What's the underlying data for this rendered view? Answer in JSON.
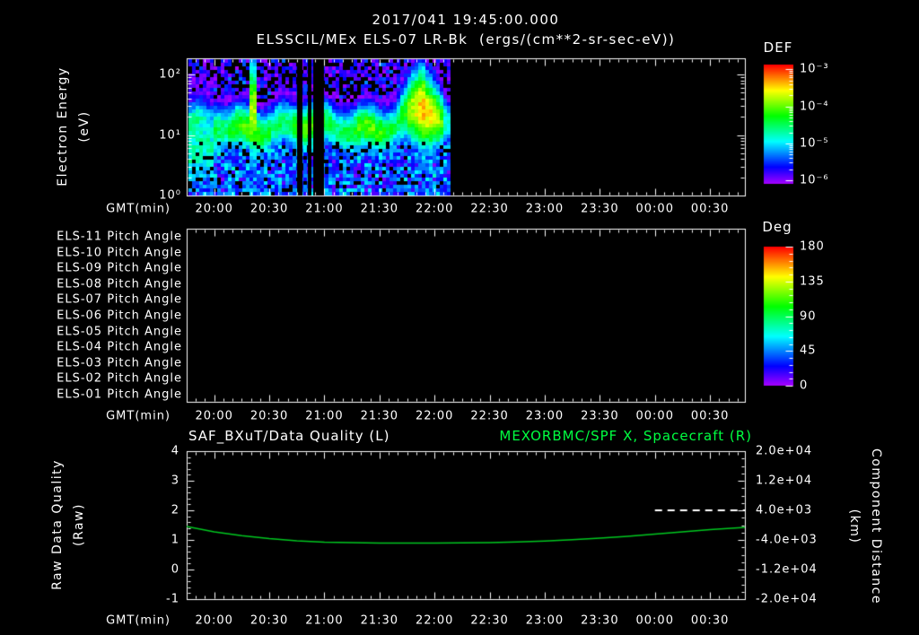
{
  "colors": {
    "background": "#000000",
    "text": "#ffffff",
    "accent_green": "#00ff41",
    "spacecraft_line": "#00c820",
    "quality_line": "#ffffff"
  },
  "title": {
    "line1": "2017/041 19:45:00.000",
    "line2": "ELSSCIL/MEx ELS-07 LR-Bk  (ergs/(cm**2-sr-sec-eV))"
  },
  "time_axis": {
    "label": "GMT(min)",
    "start": "19:45",
    "end": "00:49",
    "tick_labels": [
      "20:00",
      "20:30",
      "21:00",
      "21:30",
      "22:00",
      "22:30",
      "23:00",
      "23:30",
      "00:00",
      "00:30"
    ]
  },
  "panels": {
    "spectrogram": {
      "ylabel": {
        "line1": "Electron Energy",
        "line2": "(eV)"
      },
      "yticks": [
        "10⁰",
        "10¹",
        "10²"
      ],
      "colorbar": {
        "title": "DEF",
        "ticks": [
          "10⁻³",
          "10⁻⁴",
          "10⁻⁵",
          "10⁻⁶"
        ]
      }
    },
    "pitch_angle": {
      "row_labels": [
        "ELS-11 Pitch Angle",
        "ELS-10 Pitch Angle",
        "ELS-09 Pitch Angle",
        "ELS-08 Pitch Angle",
        "ELS-07 Pitch Angle",
        "ELS-06 Pitch Angle",
        "ELS-05 Pitch Angle",
        "ELS-04 Pitch Angle",
        "ELS-03 Pitch Angle",
        "ELS-02 Pitch Angle",
        "ELS-01 Pitch Angle"
      ],
      "colorbar": {
        "title": "Deg",
        "ticks": [
          "180",
          "135",
          "90",
          "45",
          "0"
        ]
      }
    },
    "timeseries": {
      "title_left": "SAF_BXuT/Data Quality (L)",
      "title_right": "MEXORBMC/SPF X, Spacecraft (R)",
      "ylabel_left": {
        "line1": "Raw Data Quality",
        "line2": "(Raw)"
      },
      "ylabel_right": {
        "line1": "Component Distance",
        "line2": "(km)"
      },
      "yticks_left": [
        "4",
        "3",
        "2",
        "1",
        "0",
        "-1"
      ],
      "yticks_right": [
        "2.0e+04",
        "1.2e+04",
        "4.0e+03",
        "-4.0e+03",
        "-1.2e+04",
        "-2.0e+04"
      ]
    }
  },
  "chart_data": [
    {
      "type": "heatmap",
      "title": "ELSSCIL/MEx ELS-07 LR-Bk electron energy spectrogram",
      "xlabel": "GMT(min)",
      "ylabel": "Electron Energy (eV)",
      "y_scale": "log",
      "y_range_eV": [
        1,
        180
      ],
      "x_range": [
        "19:45",
        "00:49"
      ],
      "colorbar": {
        "label": "DEF",
        "units": "ergs/(cm**2-sr-sec-eV)",
        "scale": "log",
        "range_ticks": [
          "1e-3",
          "1e-4",
          "1e-5",
          "1e-6"
        ]
      },
      "features": {
        "data_start": "19:46",
        "data_end": "22:08",
        "main_band_eV": [
          6,
          40
        ],
        "low_energy_background_eV": [
          1,
          5
        ],
        "start_cold_column": [
          "19:46",
          "19:58"
        ],
        "bright_column": [
          "20:19",
          "20:21"
        ],
        "dropout_gaps": [
          [
            "20:45",
            "20:48"
          ],
          [
            "20:51",
            "20:53"
          ],
          [
            "20:54",
            "21:00"
          ]
        ],
        "enhancement": {
          "start": "21:33",
          "end": "22:02",
          "peak": "21:52",
          "max_energy_eV": 120
        },
        "description": "Green-yellow flux band near 10-40 eV over blue/violet background; black above ~100 eV with violet speckle; no data after 22:08"
      }
    },
    {
      "type": "heatmap",
      "title": "ELS pitch angle panels",
      "status": "no data plotted",
      "rows": [
        "ELS-11",
        "ELS-10",
        "ELS-09",
        "ELS-08",
        "ELS-07",
        "ELS-06",
        "ELS-05",
        "ELS-04",
        "ELS-03",
        "ELS-02",
        "ELS-01"
      ],
      "colorbar": {
        "label": "Deg",
        "range": [
          0,
          180
        ],
        "ticks": [
          180,
          135,
          90,
          45,
          0
        ]
      }
    },
    {
      "type": "line",
      "xlabel": "GMT(min)",
      "ylim_left": [
        -1,
        4
      ],
      "ylim_right": [
        -20000,
        20000
      ],
      "series": [
        {
          "name": "SAF_BXuT/Data Quality (L)",
          "axis": "left",
          "color": "#ffffff",
          "style": "dashed",
          "points": [
            [
              "00:00",
              2
            ],
            [
              "00:49",
              2
            ]
          ]
        },
        {
          "name": "MEXORBMC/SPF X, Spacecraft (R)",
          "axis": "right",
          "units": "km",
          "color": "#00c820",
          "style": "solid",
          "points": [
            [
              "19:45",
              -360
            ],
            [
              "20:00",
              -1800
            ],
            [
              "20:15",
              -2850
            ],
            [
              "20:30",
              -3650
            ],
            [
              "20:45",
              -4250
            ],
            [
              "21:00",
              -4600
            ],
            [
              "21:15",
              -4750
            ],
            [
              "21:30",
              -4820
            ],
            [
              "21:45",
              -4850
            ],
            [
              "22:00",
              -4850
            ],
            [
              "22:15",
              -4800
            ],
            [
              "22:30",
              -4700
            ],
            [
              "22:45",
              -4530
            ],
            [
              "23:00",
              -4280
            ],
            [
              "23:15",
              -3950
            ],
            [
              "23:30",
              -3530
            ],
            [
              "23:45",
              -3020
            ],
            [
              "00:00",
              -2440
            ],
            [
              "00:15",
              -1830
            ],
            [
              "00:30",
              -1220
            ],
            [
              "00:49",
              -600
            ]
          ]
        }
      ]
    }
  ]
}
